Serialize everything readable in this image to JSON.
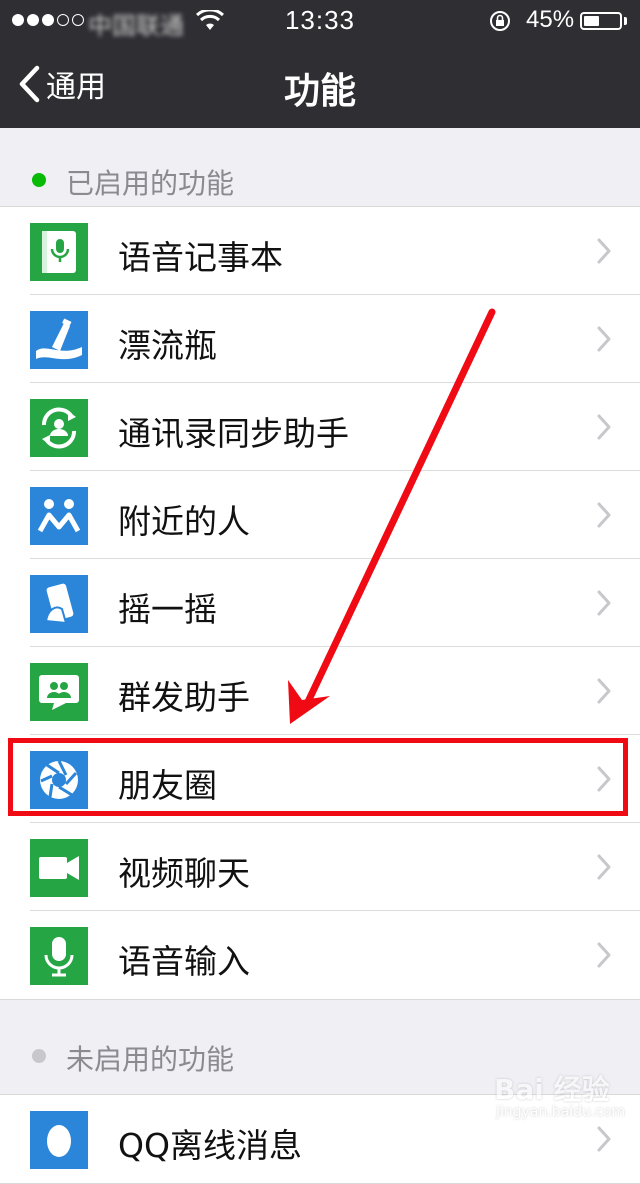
{
  "status_bar": {
    "carrier": "中国联通",
    "time": "13:33",
    "battery_percent": "45%",
    "battery_level": 0.45
  },
  "nav": {
    "back_label": "通用",
    "title": "功能"
  },
  "sections": {
    "enabled": {
      "title": "已启用的功能",
      "dot_color": "#09bb07",
      "items": [
        {
          "label": "语音记事本",
          "icon": "voice-notepad-icon",
          "color": "#26a544"
        },
        {
          "label": "漂流瓶",
          "icon": "drift-bottle-icon",
          "color": "#2b86d9"
        },
        {
          "label": "通讯录同步助手",
          "icon": "contact-sync-icon",
          "color": "#26a544"
        },
        {
          "label": "附近的人",
          "icon": "people-nearby-icon",
          "color": "#2b86d9"
        },
        {
          "label": "摇一摇",
          "icon": "shake-icon",
          "color": "#2b86d9"
        },
        {
          "label": "群发助手",
          "icon": "broadcast-helper-icon",
          "color": "#26a544"
        },
        {
          "label": "朋友圈",
          "icon": "moments-icon",
          "color": "#2b86d9"
        },
        {
          "label": "视频聊天",
          "icon": "video-chat-icon",
          "color": "#26a544"
        },
        {
          "label": "语音输入",
          "icon": "voice-input-icon",
          "color": "#26a544"
        }
      ]
    },
    "disabled": {
      "title": "未启用的功能",
      "dot_color": "#c7c7cc",
      "items": [
        {
          "label": "QQ离线消息",
          "icon": "qq-offline-icon",
          "color": "#2b86d9"
        }
      ]
    }
  },
  "annotation": {
    "highlight_color": "#f00a14"
  },
  "watermark": {
    "logo": "Bai 经验",
    "url": "jingyan.baidu.com"
  }
}
